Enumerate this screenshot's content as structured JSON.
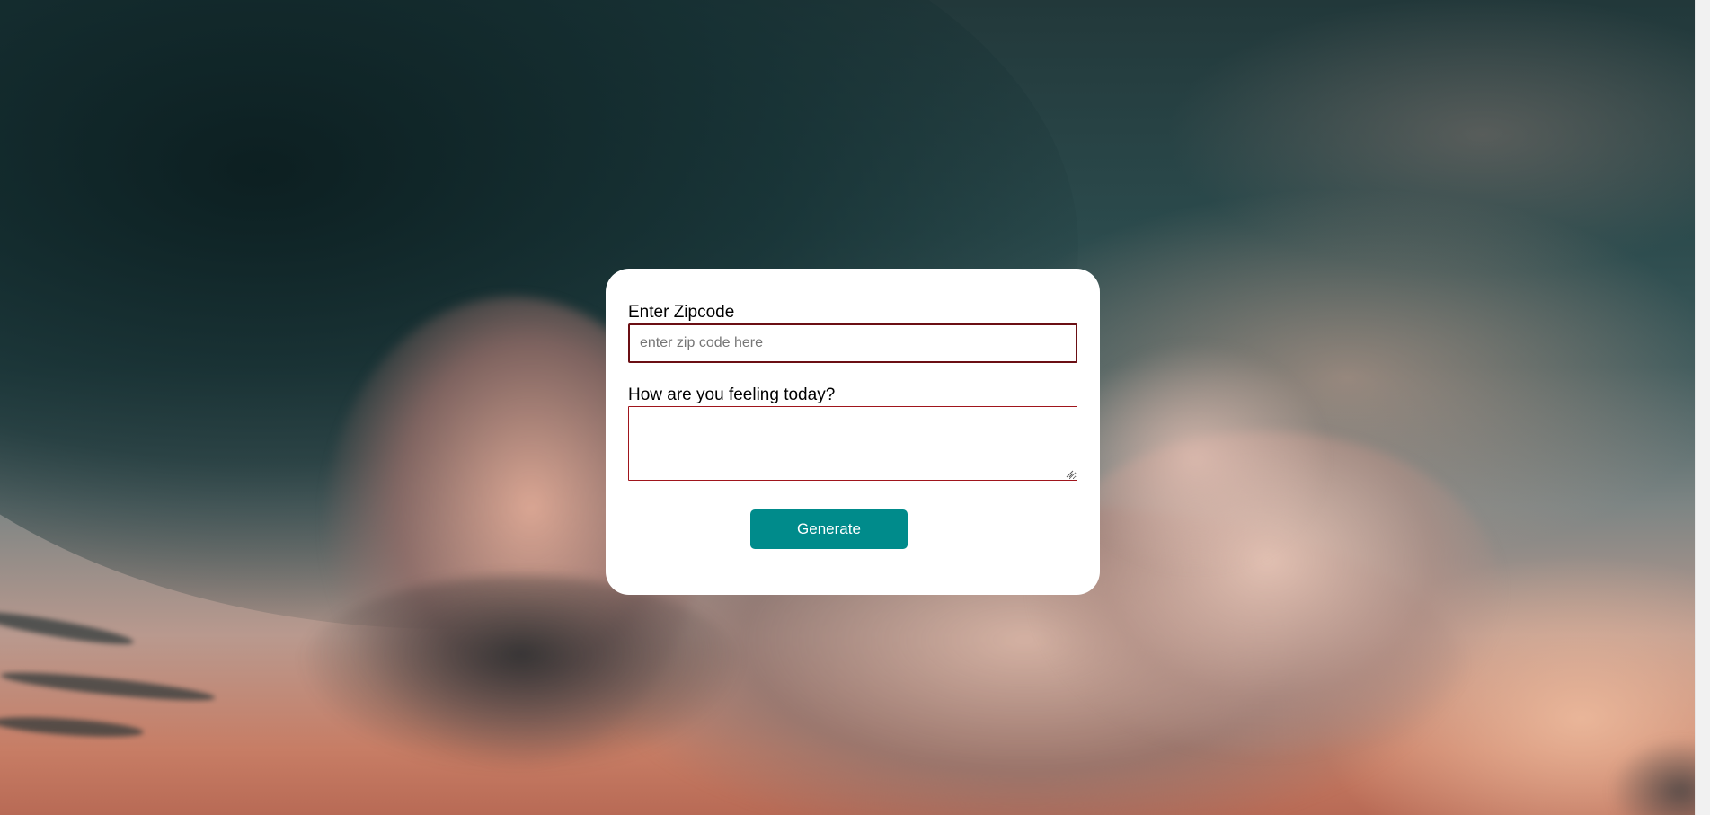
{
  "background": {
    "description_icon": "stormy-sky-background-image"
  },
  "form": {
    "zip_label": "Enter Zipcode",
    "zip_placeholder": "enter zip code here",
    "zip_value": "",
    "feeling_label": "How are you feeling today?",
    "feeling_value": "",
    "generate_label": "Generate"
  },
  "colors": {
    "card_bg": "#ffffff",
    "input_border": "#6b0f14",
    "button_bg": "#008b8b",
    "button_text": "#ffffff"
  }
}
